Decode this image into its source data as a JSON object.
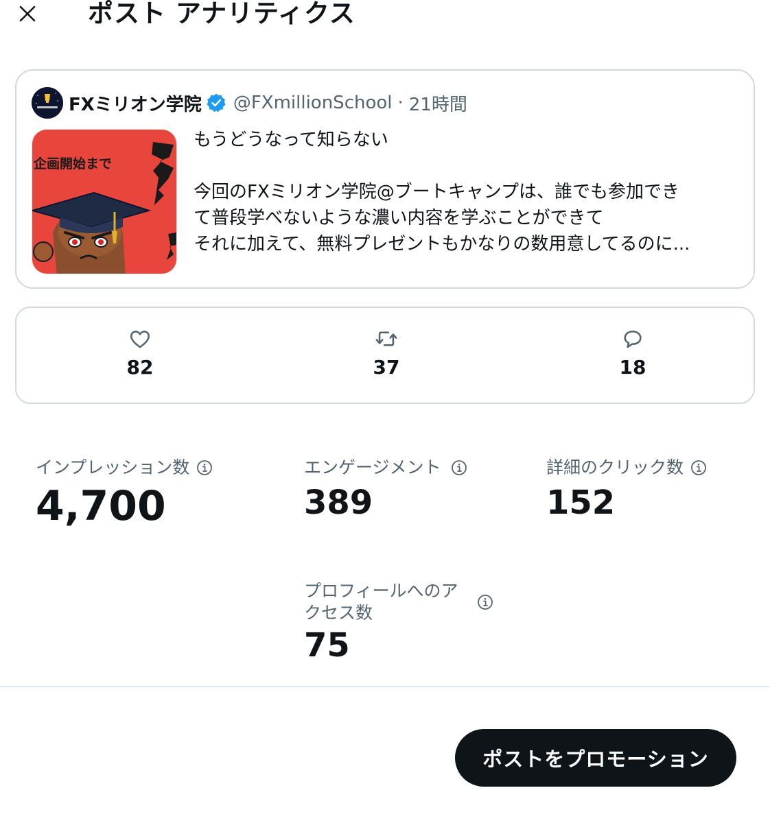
{
  "header": {
    "title": "ポスト アナリティクス"
  },
  "post": {
    "author_name": "FXミリオン学院",
    "author_handle": "@FXmillionSchool",
    "separator": "·",
    "time": "21時間",
    "thumbnail_caption": "企画開始まで",
    "text_lines": [
      "もうどうなって知らない",
      "",
      "今回のFXミリオン学院@ブートキャンプは、誰でも参加でき",
      "て普段学べないような濃い内容を学ぶことができて",
      "それに加えて、無料プレゼントもかなりの数用意してるのに..."
    ]
  },
  "engagement": {
    "likes": "82",
    "reposts": "37",
    "replies": "18"
  },
  "metrics": {
    "impressions": {
      "label": "インプレッション数",
      "value": "4,700"
    },
    "engagements": {
      "label": "エンゲージメント",
      "value": "389"
    },
    "detail_clicks": {
      "label": "詳細のクリック数",
      "value": "152"
    },
    "profile_visits": {
      "label_line1": "プロフィールへのア",
      "label_line2": "クセス数",
      "value": "75"
    }
  },
  "footer": {
    "promote_label": "ポストをプロモーション"
  },
  "colors": {
    "text_primary": "#0f1419",
    "text_secondary": "#536471",
    "border": "#cfd9de",
    "verified_blue": "#1d9bf0",
    "button_bg": "#0f1419",
    "thumbnail_bg": "#e8453c"
  }
}
